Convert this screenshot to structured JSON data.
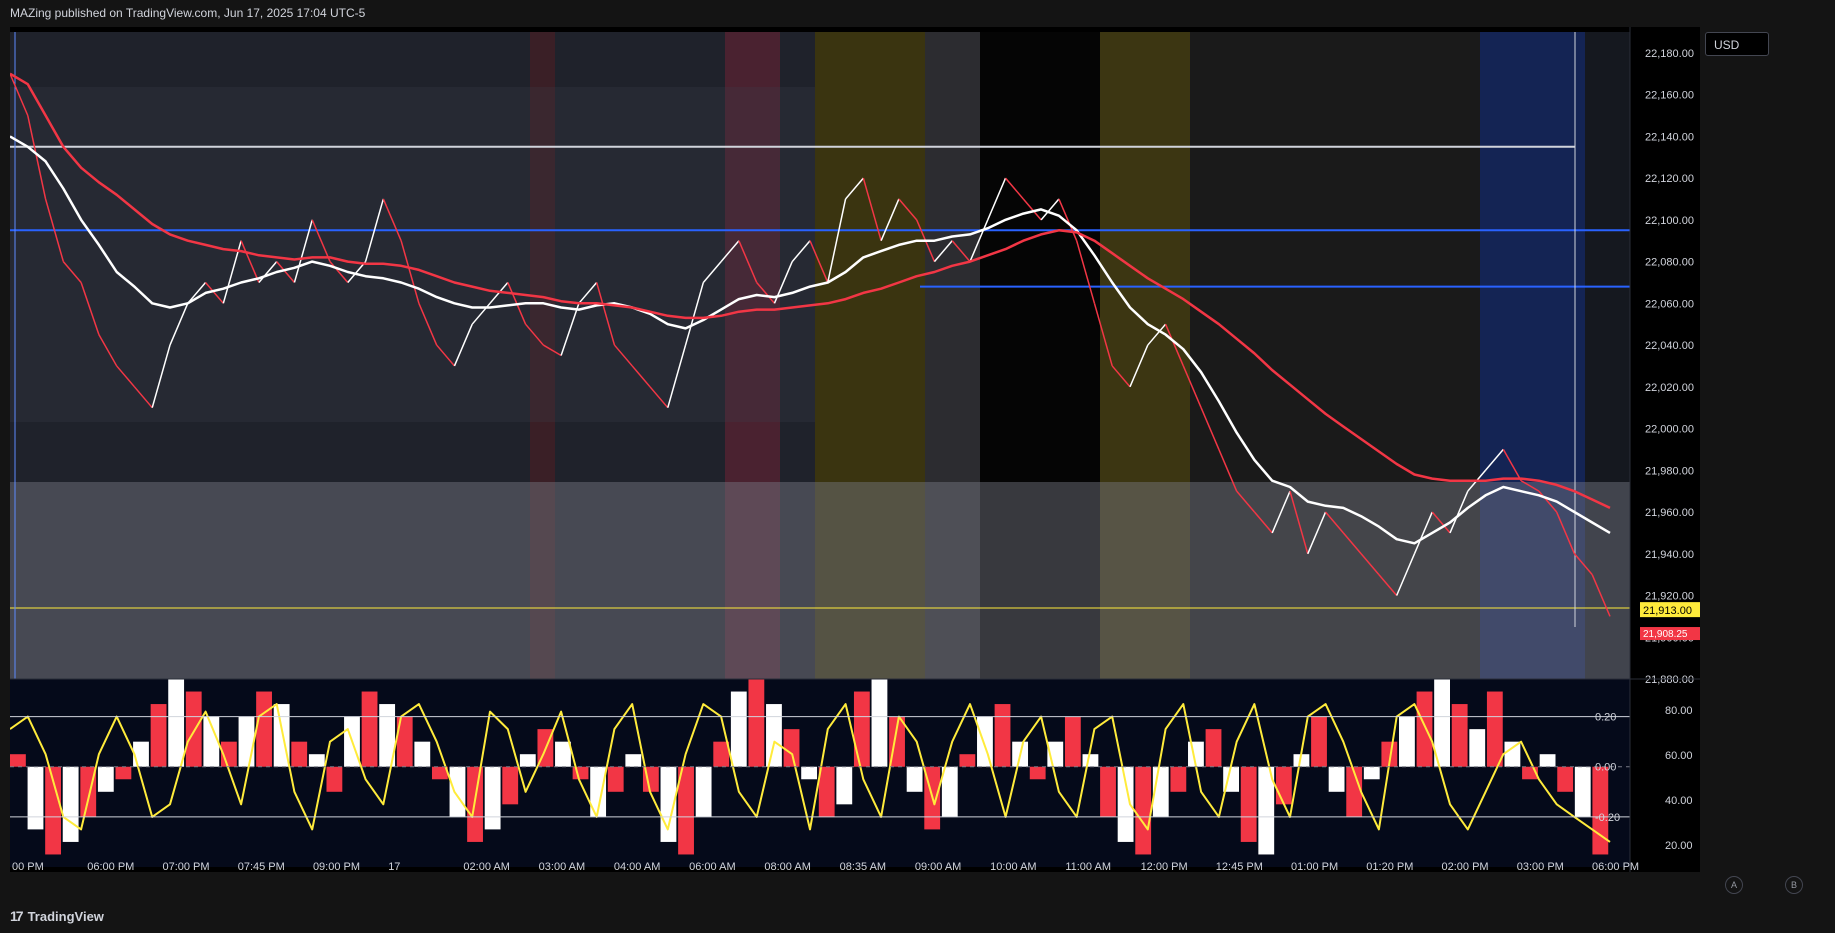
{
  "header": {
    "text": "MAZing published on TradingView.com, Jun 17, 2025 17:04 UTC-5"
  },
  "currency": "USD",
  "footer": {
    "brand": "TradingView"
  },
  "corner_buttons": {
    "a": "A",
    "b": "B"
  },
  "colors": {
    "candles_up": "#ffffff",
    "candles_down": "#f23645",
    "ma_fast": "#ffffff",
    "ma_slow": "#f23645",
    "level": "#2962ff",
    "osc_line": "#ffeb3b"
  },
  "chart_data": [
    {
      "type": "line",
      "title": "",
      "ylim": [
        21880,
        22190
      ],
      "y_ticks": [
        "22,180.00",
        "22,160.00",
        "22,140.00",
        "22,120.00",
        "22,100.00",
        "22,080.00",
        "22,060.00",
        "22,040.00",
        "22,020.00",
        "22,000.00",
        "21,980.00",
        "21,960.00",
        "21,940.00",
        "21,920.00",
        "21,900.00",
        "21,880.00"
      ],
      "x_ticks": [
        "00 PM",
        "06:00 PM",
        "07:00 PM",
        "07:45 PM",
        "09:00 PM",
        "17",
        "02:00 AM",
        "03:00 AM",
        "04:00 AM",
        "06:00 AM",
        "08:00 AM",
        "08:35 AM",
        "09:00 AM",
        "10:00 AM",
        "11:00 AM",
        "12:00 PM",
        "12:45 PM",
        "01:00 PM",
        "01:20 PM",
        "02:00 PM",
        "03:00 PM",
        "06:00 PM"
      ],
      "price_labels": {
        "last": "21,913.00",
        "previous": "21,908.25"
      },
      "horizontal_levels": [
        22135,
        22095,
        22068,
        21914
      ],
      "series": [
        {
          "values": [
            22170,
            22150,
            22110,
            22080,
            22070,
            22045,
            22030,
            22020,
            22010,
            22040,
            22060,
            22070,
            22060,
            22090,
            22070,
            22080,
            22070,
            22100,
            22080,
            22070,
            22080,
            22110,
            22090,
            22060,
            22040,
            22030,
            22050,
            22060,
            22070,
            22050,
            22040,
            22035,
            22060,
            22070,
            22040,
            22030,
            22020,
            22010,
            22040,
            22070,
            22080,
            22090,
            22070,
            22060,
            22080,
            22090,
            22070,
            22110,
            22120,
            22090,
            22110,
            22100,
            22080,
            22090,
            22080,
            22100,
            22120,
            22110,
            22100,
            22110,
            22090,
            22060,
            22030,
            22020,
            22040,
            22050,
            22030,
            22010,
            21990,
            21970,
            21960,
            21950,
            21970,
            21940,
            21960,
            21950,
            21940,
            21930,
            21920,
            21940,
            21960,
            21950,
            21970,
            21980,
            21990,
            21975,
            21970,
            21960,
            21940,
            21930,
            21910
          ]
        },
        {
          "values": [
            22140,
            22135,
            22128,
            22115,
            22100,
            22088,
            22075,
            22068,
            22060,
            22058,
            22060,
            22065,
            22067,
            22070,
            22072,
            22075,
            22077,
            22080,
            22078,
            22075,
            22073,
            22072,
            22070,
            22067,
            22063,
            22060,
            22058,
            22058,
            22059,
            22060,
            22060,
            22058,
            22057,
            22059,
            22060,
            22058,
            22055,
            22050,
            22048,
            22052,
            22057,
            22062,
            22064,
            22063,
            22065,
            22068,
            22070,
            22075,
            22082,
            22085,
            22088,
            22090,
            22090,
            22092,
            22093,
            22096,
            22100,
            22103,
            22105,
            22102,
            22095,
            22083,
            22070,
            22058,
            22050,
            22045,
            22038,
            22027,
            22013,
            21998,
            21985,
            21975,
            21972,
            21965,
            21963,
            21962,
            21958,
            21953,
            21947,
            21945,
            21950,
            21955,
            21962,
            21968,
            21972,
            21970,
            21968,
            21965,
            21960,
            21955,
            21950
          ]
        },
        {
          "values": [
            22170,
            22165,
            22150,
            22135,
            22125,
            22118,
            22112,
            22105,
            22098,
            22093,
            22090,
            22088,
            22086,
            22085,
            22083,
            22082,
            22081,
            22082,
            22082,
            22080,
            22079,
            22079,
            22078,
            22076,
            22073,
            22070,
            22068,
            22066,
            22065,
            22064,
            22063,
            22061,
            22060,
            22060,
            22059,
            22058,
            22056,
            22054,
            22053,
            22053,
            22054,
            22056,
            22057,
            22057,
            22058,
            22059,
            22060,
            22062,
            22065,
            22067,
            22070,
            22073,
            22075,
            22078,
            22080,
            22083,
            22086,
            22090,
            22093,
            22095,
            22094,
            22090,
            22084,
            22078,
            22072,
            22067,
            22062,
            22056,
            22050,
            22043,
            22036,
            22028,
            22021,
            22014,
            22007,
            22001,
            21995,
            21989,
            21983,
            21978,
            21976,
            21975,
            21975,
            21975,
            21976,
            21976,
            21975,
            21973,
            21970,
            21966,
            21962
          ]
        }
      ]
    },
    {
      "type": "line",
      "title": "",
      "ylim": [
        -0.4,
        0.35
      ],
      "y_ticks_left": [
        "0.20",
        "0.00",
        "-0.20"
      ],
      "y_ticks_right": [
        "80.00",
        "60.00",
        "40.00",
        "20.00"
      ],
      "series": [
        {
          "values": [
            0.05,
            -0.25,
            -0.35,
            -0.3,
            -0.2,
            -0.1,
            -0.05,
            0.1,
            0.25,
            0.35,
            0.3,
            0.2,
            0.1,
            0.2,
            0.3,
            0.25,
            0.1,
            0.05,
            -0.1,
            0.2,
            0.3,
            0.25,
            0.2,
            0.1,
            -0.05,
            -0.2,
            -0.3,
            -0.25,
            -0.15,
            0.05,
            0.15,
            0.1,
            -0.05,
            -0.2,
            -0.1,
            0.05,
            -0.1,
            -0.3,
            -0.35,
            -0.2,
            0.1,
            0.3,
            0.35,
            0.25,
            0.15,
            -0.05,
            -0.2,
            -0.15,
            0.3,
            0.35,
            0.2,
            -0.1,
            -0.25,
            -0.2,
            0.05,
            0.2,
            0.25,
            0.1,
            -0.05,
            0.1,
            0.2,
            0.05,
            -0.2,
            -0.3,
            -0.35,
            -0.2,
            -0.1,
            0.1,
            0.15,
            -0.1,
            -0.3,
            -0.35,
            -0.15,
            0.05,
            0.2,
            -0.1,
            -0.2,
            -0.05,
            0.1,
            0.2,
            0.3,
            0.35,
            0.25,
            0.15,
            0.3,
            0.1,
            -0.05,
            0.05,
            -0.1,
            -0.2,
            -0.35
          ]
        },
        {
          "values": [
            0.15,
            0.2,
            0.05,
            -0.2,
            -0.25,
            0.05,
            0.2,
            0.05,
            -0.2,
            -0.15,
            0.1,
            0.22,
            0.05,
            -0.15,
            0.2,
            0.25,
            -0.1,
            -0.25,
            0.1,
            0.15,
            -0.05,
            -0.15,
            0.2,
            0.25,
            0.1,
            -0.1,
            -0.2,
            0.22,
            0.15,
            -0.1,
            0.05,
            0.22,
            -0.05,
            -0.2,
            0.15,
            0.25,
            -0.1,
            -0.25,
            0.05,
            0.25,
            0.2,
            -0.1,
            -0.2,
            0.1,
            0.05,
            -0.25,
            0.15,
            0.25,
            -0.05,
            -0.2,
            0.2,
            0.1,
            -0.15,
            0.1,
            0.25,
            0.05,
            -0.2,
            0.1,
            0.2,
            -0.1,
            -0.2,
            0.15,
            0.2,
            -0.15,
            -0.25,
            0.15,
            0.25,
            -0.1,
            -0.2,
            0.1,
            0.25,
            -0.05,
            -0.2,
            0.2,
            0.25,
            0.1,
            -0.1,
            -0.25,
            0.2,
            0.25,
            0.1,
            -0.15,
            -0.25,
            -0.1,
            0.05,
            0.1,
            -0.05,
            -0.15,
            -0.2,
            -0.25,
            -0.3
          ]
        }
      ]
    }
  ]
}
